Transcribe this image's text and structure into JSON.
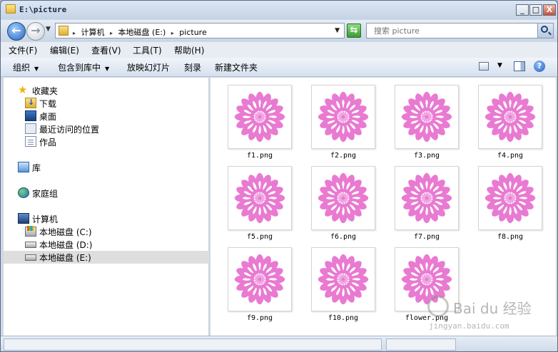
{
  "window": {
    "title": "E:\\picture",
    "minimize": "_",
    "maximize": "□",
    "close": "X"
  },
  "address": {
    "crumbs": [
      "计算机",
      "本地磁盘 (E:)",
      "picture"
    ],
    "search_placeholder": "搜索 picture"
  },
  "menu": [
    "文件(F)",
    "编辑(E)",
    "查看(V)",
    "工具(T)",
    "帮助(H)"
  ],
  "toolbar": {
    "organize": "组织",
    "include_in_library": "包含到库中",
    "slideshow": "放映幻灯片",
    "burn": "刻录",
    "new_folder": "新建文件夹"
  },
  "nav": {
    "favorites": "收藏夹",
    "downloads": "下载",
    "desktop": "桌面",
    "recent": "最近访问的位置",
    "works": "作品",
    "libraries": "库",
    "homegroup": "家庭组",
    "computer": "计算机",
    "drive_c": "本地磁盘 (C:)",
    "drive_d": "本地磁盘 (D:)",
    "drive_e": "本地磁盘 (E:)"
  },
  "files": [
    "f1.png",
    "f2.png",
    "f3.png",
    "f4.png",
    "f5.png",
    "f6.png",
    "f7.png",
    "f8.png",
    "f9.png",
    "f10.png",
    "flower.png"
  ],
  "watermark": {
    "brand": "Bai du 经验",
    "url": "jingyan.baidu.com"
  },
  "colors": {
    "petal": "#e97ad1",
    "petal_inner": "#ffffff",
    "center": "#f0a6e2"
  }
}
